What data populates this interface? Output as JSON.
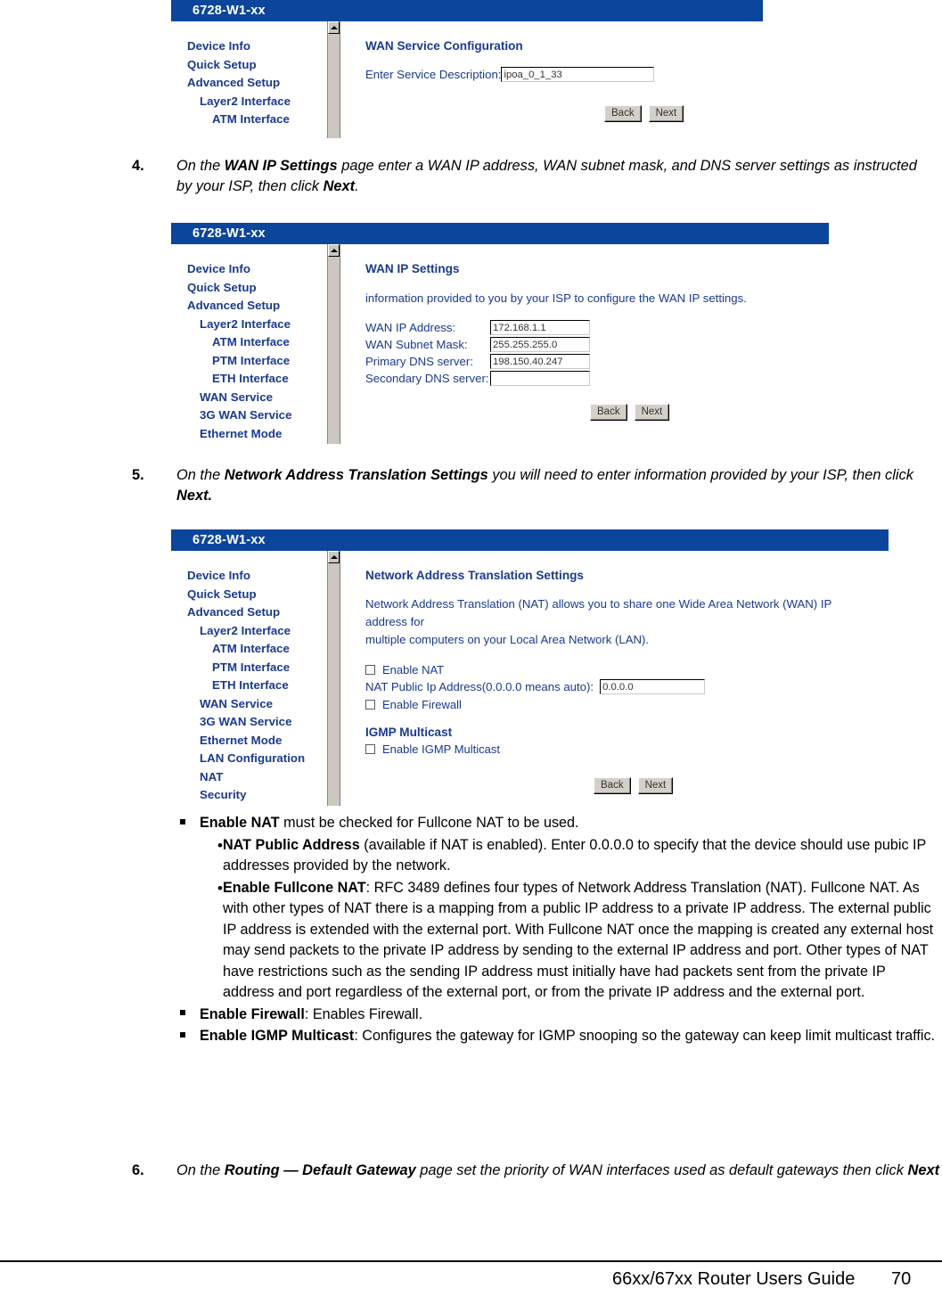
{
  "document": {
    "footer_title": "66xx/67xx Router Users Guide",
    "footer_page": "70"
  },
  "screenshot_wan_service": {
    "title": "6728-W1-xx",
    "nav": [
      {
        "label": "Device Info",
        "level": 1
      },
      {
        "label": "Quick Setup",
        "level": 1
      },
      {
        "label": "Advanced Setup",
        "level": 1
      },
      {
        "label": "Layer2 Interface",
        "level": 2
      },
      {
        "label": "ATM Interface",
        "level": 3
      }
    ],
    "heading": "WAN Service Configuration",
    "service_description_label": "Enter Service Description:",
    "service_description_value": "ipoa_0_1_33",
    "back_label": "Back",
    "next_label": "Next"
  },
  "screenshot_wan_ip": {
    "title": "6728-W1-xx",
    "nav": [
      {
        "label": "Device Info",
        "level": 1
      },
      {
        "label": "Quick Setup",
        "level": 1
      },
      {
        "label": "Advanced Setup",
        "level": 1
      },
      {
        "label": "Layer2 Interface",
        "level": 2
      },
      {
        "label": "ATM Interface",
        "level": 3
      },
      {
        "label": "PTM Interface",
        "level": 3
      },
      {
        "label": "ETH Interface",
        "level": 3
      },
      {
        "label": "WAN Service",
        "level": 2
      },
      {
        "label": "3G WAN Service",
        "level": 2
      },
      {
        "label": "Ethernet Mode",
        "level": 2
      }
    ],
    "heading": "WAN IP Settings",
    "intro": "information provided to you by your ISP to configure the WAN IP settings.",
    "fields": [
      {
        "label": "WAN IP Address:",
        "value": "172.168.1.1"
      },
      {
        "label": "WAN Subnet Mask:",
        "value": "255.255.255.0"
      },
      {
        "label": "Primary DNS server:",
        "value": "198.150.40.247"
      },
      {
        "label": "Secondary DNS server:",
        "value": ""
      }
    ],
    "back_label": "Back",
    "next_label": "Next"
  },
  "screenshot_nat": {
    "title": "6728-W1-xx",
    "nav": [
      {
        "label": "Device Info",
        "level": 1
      },
      {
        "label": "Quick Setup",
        "level": 1
      },
      {
        "label": "Advanced Setup",
        "level": 1
      },
      {
        "label": "Layer2 Interface",
        "level": 2
      },
      {
        "label": "ATM Interface",
        "level": 3
      },
      {
        "label": "PTM Interface",
        "level": 3
      },
      {
        "label": "ETH Interface",
        "level": 3
      },
      {
        "label": "WAN Service",
        "level": 2
      },
      {
        "label": "3G WAN Service",
        "level": 2
      },
      {
        "label": "Ethernet Mode",
        "level": 2
      },
      {
        "label": "LAN Configuration",
        "level": 2
      },
      {
        "label": "NAT",
        "level": 2
      },
      {
        "label": "Security",
        "level": 2
      }
    ],
    "heading": "Network Address Translation Settings",
    "intro_line1": "Network Address Translation (NAT) allows you to share one Wide Area Network (WAN) IP address for",
    "intro_line2": "multiple computers on your Local Area Network (LAN).",
    "enable_nat_label": "Enable NAT",
    "nat_public_ip_label": "NAT Public Ip Address(0.0.0.0 means auto):",
    "nat_public_ip_value": "0.0.0.0",
    "enable_firewall_label": "Enable Firewall",
    "igmp_heading": "IGMP Multicast",
    "enable_igmp_label": "Enable IGMP Multicast",
    "back_label": "Back",
    "next_label": "Next"
  },
  "steps": {
    "step4": {
      "number": "4.",
      "parts": [
        {
          "t": "On the ",
          "b": false
        },
        {
          "t": "WAN IP Settings",
          "b": true
        },
        {
          "t": " page enter a WAN IP address, WAN subnet mask, and DNS server settings as instructed by your ISP, then click ",
          "b": false
        },
        {
          "t": "Next",
          "b": true
        },
        {
          "t": ".",
          "b": false
        }
      ]
    },
    "step5": {
      "number": "5.",
      "parts": [
        {
          "t": "On the ",
          "b": false
        },
        {
          "t": "Network Address Translation Settings",
          "b": true
        },
        {
          "t": " you will need to enter information provided by your ISP, then click ",
          "b": false
        },
        {
          "t": "Next.",
          "b": true
        }
      ]
    },
    "step6": {
      "number": "6.",
      "parts": [
        {
          "t": "On the ",
          "b": false
        },
        {
          "t": "Routing — Default Gateway",
          "b": true
        },
        {
          "t": " page set the priority of WAN interfaces used as default gateways then click ",
          "b": false
        },
        {
          "t": "Next",
          "b": true
        }
      ]
    }
  },
  "bullets": [
    {
      "level": 1,
      "parts": [
        {
          "t": "Enable NAT",
          "b": true
        },
        {
          "t": " must be checked for Fullcone NAT to be used.",
          "b": false
        }
      ]
    },
    {
      "level": 2,
      "parts": [
        {
          "t": "NAT Public Address",
          "b": true
        },
        {
          "t": " (available if NAT is enabled). Enter 0.0.0.0 to specify that the device should use pubic IP addresses provided by the network.",
          "b": false
        }
      ]
    },
    {
      "level": 2,
      "parts": [
        {
          "t": "Enable Fullcone NAT",
          "b": true
        },
        {
          "t": ": RFC 3489 defines four types of Network Address Translation (NAT). Fullcone NAT. As with other types of NAT there is a mapping from a public IP address to a private IP address. The external public IP address is extended with the external port. With Fullcone NAT once the mapping is created any external host may send packets to the private IP address by sending to the external IP address and port. Other types of NAT have restrictions such as the sending IP address must initially have had packets sent from the private IP address and port regardless of the external port, or from the private IP address and the external port.",
          "b": false
        }
      ]
    },
    {
      "level": 1,
      "parts": [
        {
          "t": "Enable Firewall",
          "b": true
        },
        {
          "t": ": Enables Firewall.",
          "b": false
        }
      ]
    },
    {
      "level": 1,
      "parts": [
        {
          "t": "Enable IGMP Multicast",
          "b": true
        },
        {
          "t": ": Configures the gateway for IGMP snooping so the gateway can keep limit multicast traffic.",
          "b": false
        }
      ]
    }
  ],
  "colors": {
    "titlebar_blue": "#0b469c",
    "nav_blue": "#1a3a8f",
    "button_face": "#d4d0c8"
  }
}
